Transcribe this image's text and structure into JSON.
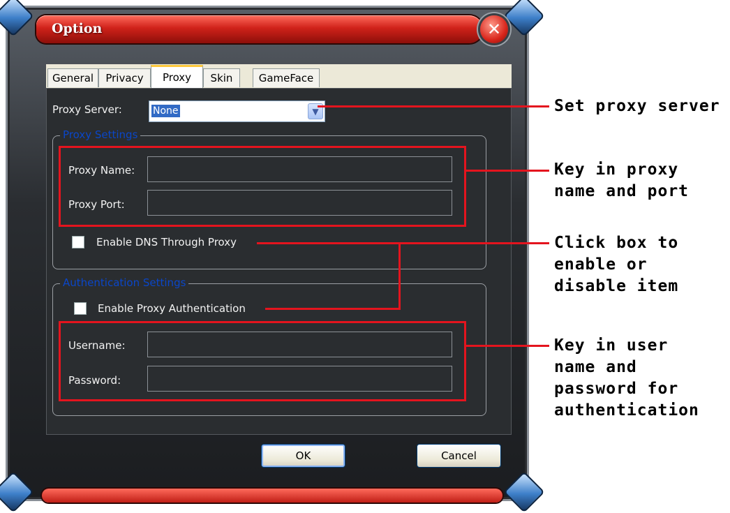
{
  "window": {
    "title": "Option",
    "close_glyph": "✕"
  },
  "tabs": [
    {
      "label": "General",
      "active": false
    },
    {
      "label": "Privacy",
      "active": false
    },
    {
      "label": "Proxy",
      "active": true
    },
    {
      "label": "Skin",
      "active": false
    },
    {
      "label": "GameFace",
      "active": false
    }
  ],
  "proxy_server": {
    "label": "Proxy Server:",
    "value": "None",
    "dropdown_icon": "chevron-down-icon"
  },
  "proxy_settings": {
    "group_title": "Proxy Settings",
    "name_label": "Proxy Name:",
    "name_value": "",
    "port_label": "Proxy Port:",
    "port_value": "",
    "dns_label": "Enable DNS Through Proxy",
    "dns_checked": false
  },
  "auth_settings": {
    "group_title": "Authentication Settings",
    "enable_label": "Enable Proxy Authentication",
    "enable_checked": false,
    "username_label": "Username:",
    "username_value": "",
    "password_label": "Password:",
    "password_value": ""
  },
  "buttons": {
    "ok": "OK",
    "cancel": "Cancel"
  },
  "annotations": {
    "set_proxy": "Set proxy server",
    "key_proxy": "Key in proxy\nname and port",
    "click_box": "Click box to\nenable or\ndisable item",
    "key_user": "Key in user\nname and\npassword for\nauthentication"
  },
  "colors": {
    "accent_red": "#e4141e",
    "title_red": "#d0221a",
    "panel_bg": "#2a2d30",
    "group_title_blue": "#0a46c8"
  }
}
